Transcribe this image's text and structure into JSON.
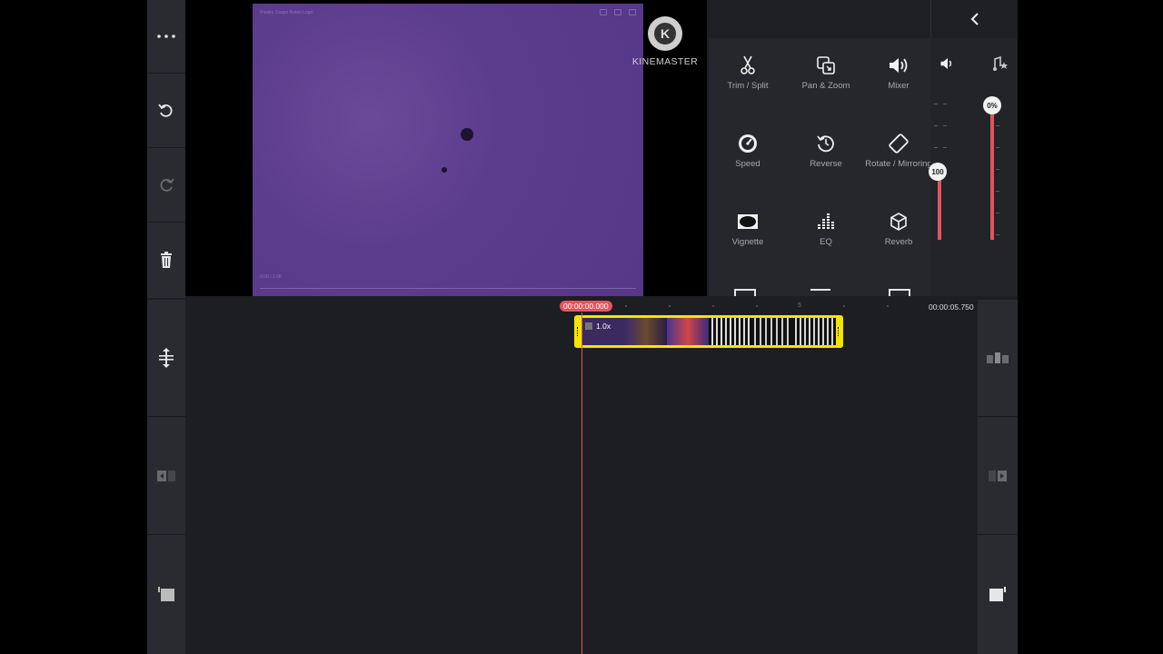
{
  "left_toolbar": {
    "top": [
      {
        "name": "more-icon",
        "glyph": "•••"
      },
      {
        "name": "undo-icon",
        "glyph": "↺"
      },
      {
        "name": "redo-icon",
        "glyph": "↻"
      },
      {
        "name": "trash-icon",
        "glyph": "🗑"
      }
    ]
  },
  "preview": {
    "video_caption": "Rivalry Csupo Robot Logo",
    "video_time": "0:00 / 1:06",
    "watermark": "KINEMASTER",
    "watermark_letter": "K",
    "background_color": "#5c3c8c"
  },
  "panel": {
    "tools": [
      {
        "label": "Trim / Split",
        "icon": "scissors-icon"
      },
      {
        "label": "Pan & Zoom",
        "icon": "pan-zoom-icon"
      },
      {
        "label": "Mixer",
        "icon": "speaker-icon"
      },
      {
        "label": "Speed",
        "icon": "speedometer-icon"
      },
      {
        "label": "Reverse",
        "icon": "reverse-icon"
      },
      {
        "label": "Rotate / Mirroring",
        "icon": "rotate-icon"
      },
      {
        "label": "Vignette",
        "icon": "vignette-icon"
      },
      {
        "label": "EQ",
        "icon": "eq-icon"
      },
      {
        "label": "Reverb",
        "icon": "reverb-icon"
      }
    ],
    "mixer": {
      "clip_volume_label": "100",
      "clip_volume": 100,
      "background_volume_label": "0%",
      "background_volume": 0,
      "accent": "#e0555f"
    }
  },
  "timeline": {
    "current_time": "00:00:00.000",
    "end_time": "00:00:05.750",
    "ruler_label": "5",
    "clip": {
      "speed": "1.0x",
      "border_color": "#f5e400"
    },
    "playhead_color": "#e35560"
  }
}
